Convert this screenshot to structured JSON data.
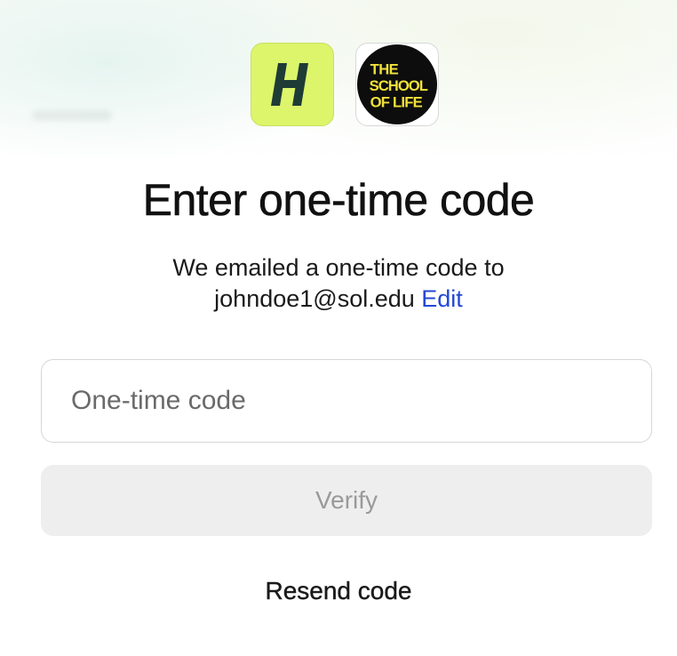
{
  "logos": {
    "primary": {
      "icon": "h-logo-icon",
      "letter": "H",
      "color": "#dcf56a"
    },
    "school": {
      "icon": "the-school-of-life-logo",
      "lines": [
        "THE",
        "SCHOOL",
        "OF LIFE"
      ],
      "color": "#f2e23a"
    }
  },
  "page": {
    "title": "Enter one-time code",
    "subtitle_line1": "We emailed a one-time code to",
    "email": "johndoe1@sol.edu",
    "edit_label": "Edit"
  },
  "form": {
    "code_placeholder": "One-time code",
    "code_value": "",
    "verify_label": "Verify",
    "resend_label": "Resend code"
  },
  "colors": {
    "accent_link": "#2447d6",
    "button_disabled_bg": "#eeeeee",
    "button_disabled_text": "#9a9a9a"
  }
}
